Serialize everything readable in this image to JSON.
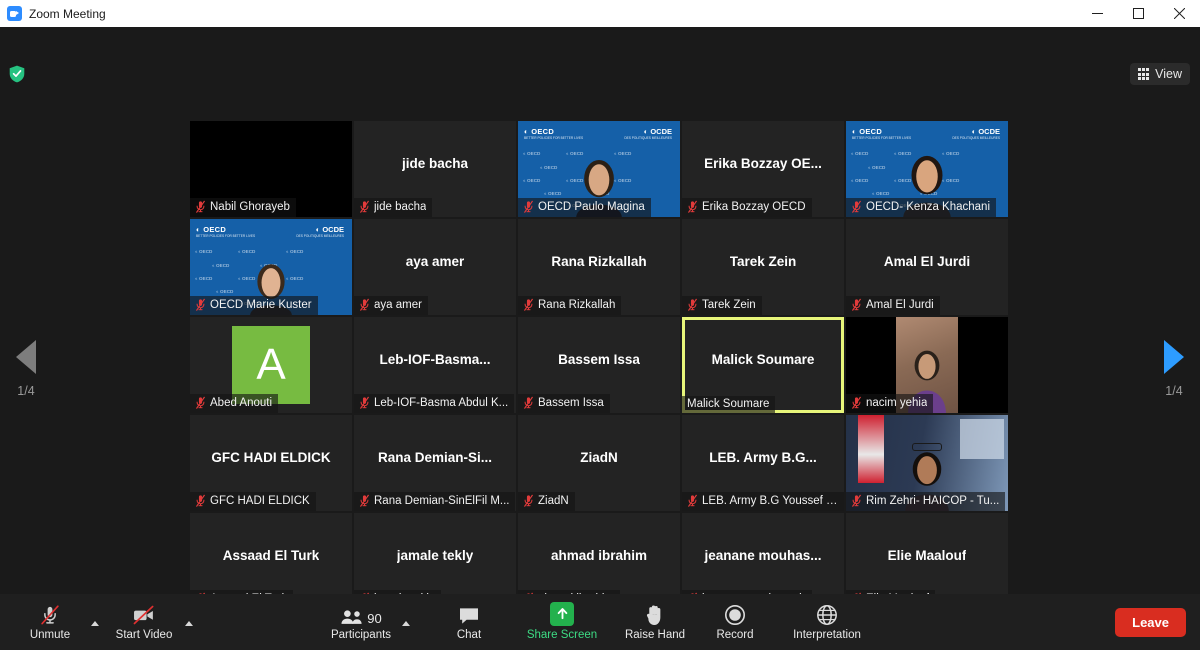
{
  "window": {
    "title": "Zoom Meeting",
    "logo_icon": "zoom-logo-icon",
    "minimize_icon": "minimize-icon",
    "maximize_icon": "maximize-icon",
    "close_icon": "close-icon"
  },
  "topbar": {
    "security_icon": "shield-check-icon",
    "view_label": "View",
    "view_icon": "grid-view-icon"
  },
  "pager": {
    "left_icon": "previous-page-arrow-icon",
    "right_icon": "next-page-arrow-icon",
    "left_label": "1/4",
    "right_label": "1/4"
  },
  "gallery": {
    "columns": 5,
    "rows": 5,
    "participants": [
      {
        "name": "Nabil Ghorayeb",
        "display": "",
        "muted": true,
        "video": "black",
        "active": false
      },
      {
        "name": "jide bacha",
        "display": "jide bacha",
        "muted": true,
        "video": "none",
        "active": false
      },
      {
        "name": "OECD Paulo Magina",
        "display": "",
        "muted": true,
        "video": "oecd-male",
        "active": false
      },
      {
        "name": "Erika Bozzay OECD",
        "display": "Erika  Bozzay  OE...",
        "muted": true,
        "video": "none",
        "active": false
      },
      {
        "name": "OECD- Kenza Khachani",
        "display": "",
        "muted": true,
        "video": "oecd-female",
        "active": false
      },
      {
        "name": "OECD Marie Kuster",
        "display": "",
        "muted": true,
        "video": "oecd-female2",
        "active": false
      },
      {
        "name": "aya amer",
        "display": "aya amer",
        "muted": true,
        "video": "none",
        "active": false
      },
      {
        "name": "Rana Rizkallah",
        "display": "Rana Rizkallah",
        "muted": true,
        "video": "none",
        "active": false
      },
      {
        "name": "Tarek Zein",
        "display": "Tarek Zein",
        "muted": true,
        "video": "none",
        "active": false
      },
      {
        "name": "Amal El Jurdi",
        "display": "Amal El Jurdi",
        "muted": true,
        "video": "none",
        "active": false
      },
      {
        "name": "Abed Anouti",
        "display": "",
        "muted": true,
        "video": "avatar",
        "initial": "A",
        "avatar_color": "#77bb41",
        "active": false
      },
      {
        "name": "Leb-IOF-Basma Abdul K...",
        "display": "Leb-IOF-Basma...",
        "muted": true,
        "video": "none",
        "active": false
      },
      {
        "name": "Bassem Issa",
        "display": "Bassem Issa",
        "muted": true,
        "video": "none",
        "active": false
      },
      {
        "name": "Malick Soumare",
        "display": "Malick Soumare",
        "muted": false,
        "video": "none",
        "active": true
      },
      {
        "name": "nacim yehia",
        "display": "",
        "muted": true,
        "video": "nacim",
        "active": false
      },
      {
        "name": "GFC HADI ELDICK",
        "display": "GFC HADI ELDICK",
        "muted": true,
        "video": "none",
        "active": false
      },
      {
        "name": "Rana Demian-SinElFil M...",
        "display": "Rana  Demian-Si...",
        "muted": true,
        "video": "none",
        "active": false
      },
      {
        "name": "ZiadN",
        "display": "ZiadN",
        "muted": true,
        "video": "none",
        "active": false
      },
      {
        "name": "LEB. Army  B.G Youssef k...",
        "display": "LEB. Army  B.G...",
        "muted": true,
        "video": "none",
        "active": false
      },
      {
        "name": "Rim Zehri- HAICOP - Tu...",
        "display": "",
        "muted": true,
        "video": "rim",
        "active": false
      },
      {
        "name": "Assaad El Turk",
        "display": "Assaad El Turk",
        "muted": true,
        "video": "none",
        "active": false
      },
      {
        "name": "jamale tekly",
        "display": "jamale tekly",
        "muted": true,
        "video": "none",
        "active": false
      },
      {
        "name": "ahmad ibrahim",
        "display": "ahmad ibrahim",
        "muted": true,
        "video": "none",
        "active": false
      },
      {
        "name": "jeanane mouhasseb",
        "display": "jeanane  mouhas...",
        "muted": true,
        "video": "none",
        "active": false
      },
      {
        "name": "Elie Maalouf",
        "display": "Elie Maalouf",
        "muted": true,
        "video": "none",
        "active": false
      }
    ],
    "oecd_logo_left": "OECD",
    "oecd_logo_left_sub": "BETTER POLICIES FOR BETTER LIVES",
    "oecd_logo_right": "OCDE",
    "oecd_logo_right_sub": "DES POLITIQUES MEILLEURES",
    "active_speaker_border_color": "#e7f57a"
  },
  "toolbar": {
    "audio_label": "Unmute",
    "audio_icon": "microphone-muted-icon",
    "audio_caret_icon": "chevron-up-icon",
    "video_label": "Start Video",
    "video_icon": "camera-off-icon",
    "video_caret_icon": "chevron-up-icon",
    "participants_label": "Participants",
    "participants_icon": "participants-icon",
    "participants_count": "90",
    "participants_caret_icon": "chevron-up-icon",
    "chat_label": "Chat",
    "chat_icon": "chat-bubble-icon",
    "share_label": "Share Screen",
    "share_icon": "share-screen-up-arrow-icon",
    "share_color": "#3ddc84",
    "raise_hand_label": "Raise Hand",
    "raise_hand_icon": "raised-hand-icon",
    "record_label": "Record",
    "record_icon": "record-circle-icon",
    "interpretation_label": "Interpretation",
    "interpretation_icon": "globe-icon",
    "leave_label": "Leave",
    "leave_color": "#d92d20"
  }
}
